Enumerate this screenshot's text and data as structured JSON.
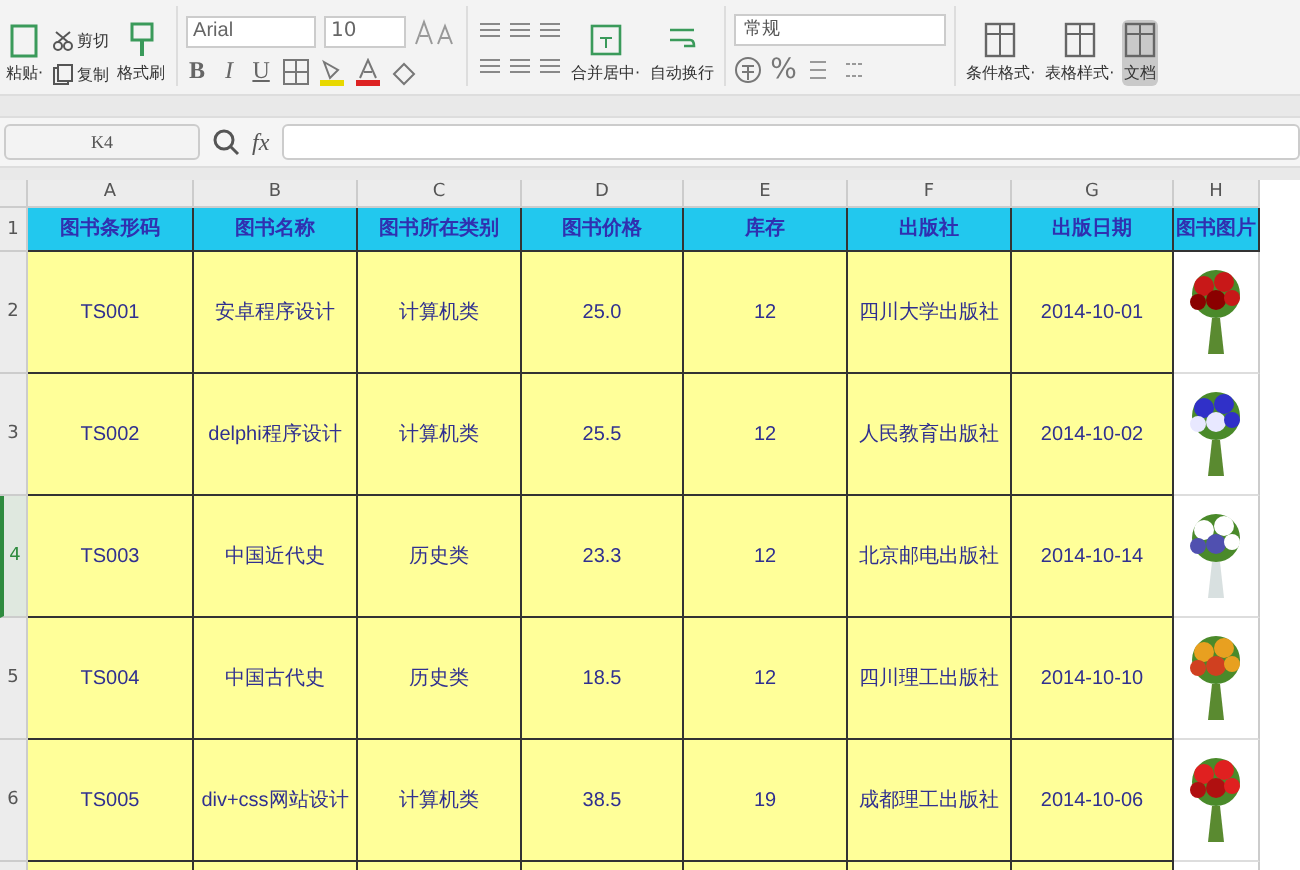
{
  "toolbar": {
    "clipboard": [
      {
        "label": "粘贴·",
        "kind": "big"
      },
      {
        "label": "剪切",
        "kind": "small"
      },
      {
        "label": "复制",
        "kind": "small"
      },
      {
        "label": "格式刷",
        "kind": "big"
      }
    ],
    "font": {
      "name": "Arial",
      "size": "10"
    },
    "format_buttons": [
      {
        "label": "B",
        "kind": "bold"
      },
      {
        "label": "I",
        "kind": "italic"
      },
      {
        "label": "U",
        "kind": "underline"
      }
    ],
    "align_buttons": [
      {
        "label": "合并居中·"
      },
      {
        "label": "自动换行"
      }
    ],
    "number_format": "常规",
    "percent": "%",
    "style_buttons": [
      {
        "label": "条件格式·"
      },
      {
        "label": "表格样式·"
      },
      {
        "label": "文档"
      }
    ]
  },
  "formula_bar": {
    "cell": "K4",
    "fx": "fx"
  },
  "columns": [
    "A",
    "B",
    "C",
    "D",
    "E",
    "F",
    "G",
    "H"
  ],
  "header_row": {
    "number": "1",
    "cells": [
      "图书条形码",
      "图书名称",
      "图书所在类别",
      "图书价格",
      "库存",
      "出版社",
      "出版日期",
      "图书图片"
    ]
  },
  "rows": [
    {
      "number": "2",
      "selected": false,
      "cells": [
        "TS001",
        "安卓程序设计",
        "计算机类",
        "25.0",
        "12",
        "四川大学出版社",
        "2014-10-01"
      ],
      "picture": {
        "kind": "picture"
      }
    },
    {
      "number": "3",
      "selected": false,
      "cells": [
        "TS002",
        "delphi程序设计",
        "计算机类",
        "25.5",
        "12",
        "人民教育出版社",
        "2014-10-02"
      ],
      "picture": {
        "kind": "picture"
      }
    },
    {
      "number": "4",
      "selected": true,
      "cells": [
        "TS003",
        "中国近代史",
        "历史类",
        "23.3",
        "12",
        "北京邮电出版社",
        "2014-10-14"
      ],
      "picture": {
        "kind": "picture"
      }
    },
    {
      "number": "5",
      "selected": false,
      "cells": [
        "TS004",
        "中国古代史",
        "历史类",
        "18.5",
        "12",
        "四川理工出版社",
        "2014-10-10"
      ],
      "picture": {
        "kind": "picture"
      }
    },
    {
      "number": "6",
      "selected": false,
      "cells": [
        "TS005",
        "div+css网站设计",
        "计算机类",
        "38.5",
        "19",
        "成都理工出版社",
        "2014-10-06"
      ],
      "picture": {
        "kind": "picture"
      }
    }
  ]
}
